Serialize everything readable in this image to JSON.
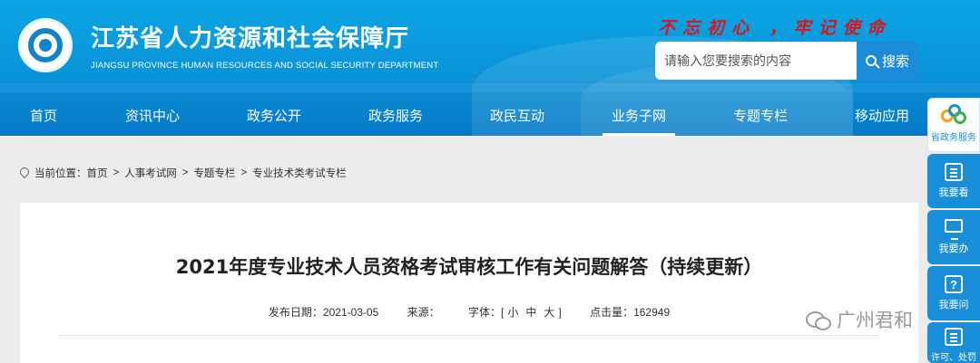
{
  "header": {
    "site_title": "江苏省人力资源和社会保障厅",
    "site_subtitle": "JIANGSU PROVINCE HUMAN RESOURCES AND SOCIAL SECURITY DEPARTMENT",
    "slogan": "不忘初心 ，牢记使命",
    "search_placeholder": "请输入您要搜索的内容",
    "search_button": "搜索"
  },
  "nav": {
    "items": [
      "首页",
      "资讯中心",
      "政务公开",
      "政务服务",
      "政民互动",
      "业务子网",
      "专题专栏",
      "移动应用"
    ],
    "active": "业务子网"
  },
  "breadcrumb": {
    "prefix": "当前位置：",
    "items": [
      "首页",
      "人事考试网",
      "专题专栏",
      "专业技术类考试专栏"
    ],
    "separator": ">"
  },
  "article": {
    "title": "2021年度专业技术人员资格考试审核工作有关问题解答（持续更新）",
    "publish_label": "发布日期：",
    "publish_date": "2021-03-05",
    "source_label": "来源：",
    "source_value": "",
    "font_label": "字体：[",
    "font_small": "小",
    "font_medium": "中",
    "font_large": "大",
    "font_close": "]",
    "hits_label": "点击量：",
    "hits_value": "162949"
  },
  "sidebar": {
    "items": [
      "省政务服务",
      "我要看",
      "我要办",
      "我要问",
      "许可、处罚"
    ]
  },
  "watermark": {
    "text": "广州君和"
  },
  "colors": {
    "banner_blue": "#0a93d8",
    "slogan_red": "#d8161c",
    "side_blue": "#1a8fd9"
  }
}
